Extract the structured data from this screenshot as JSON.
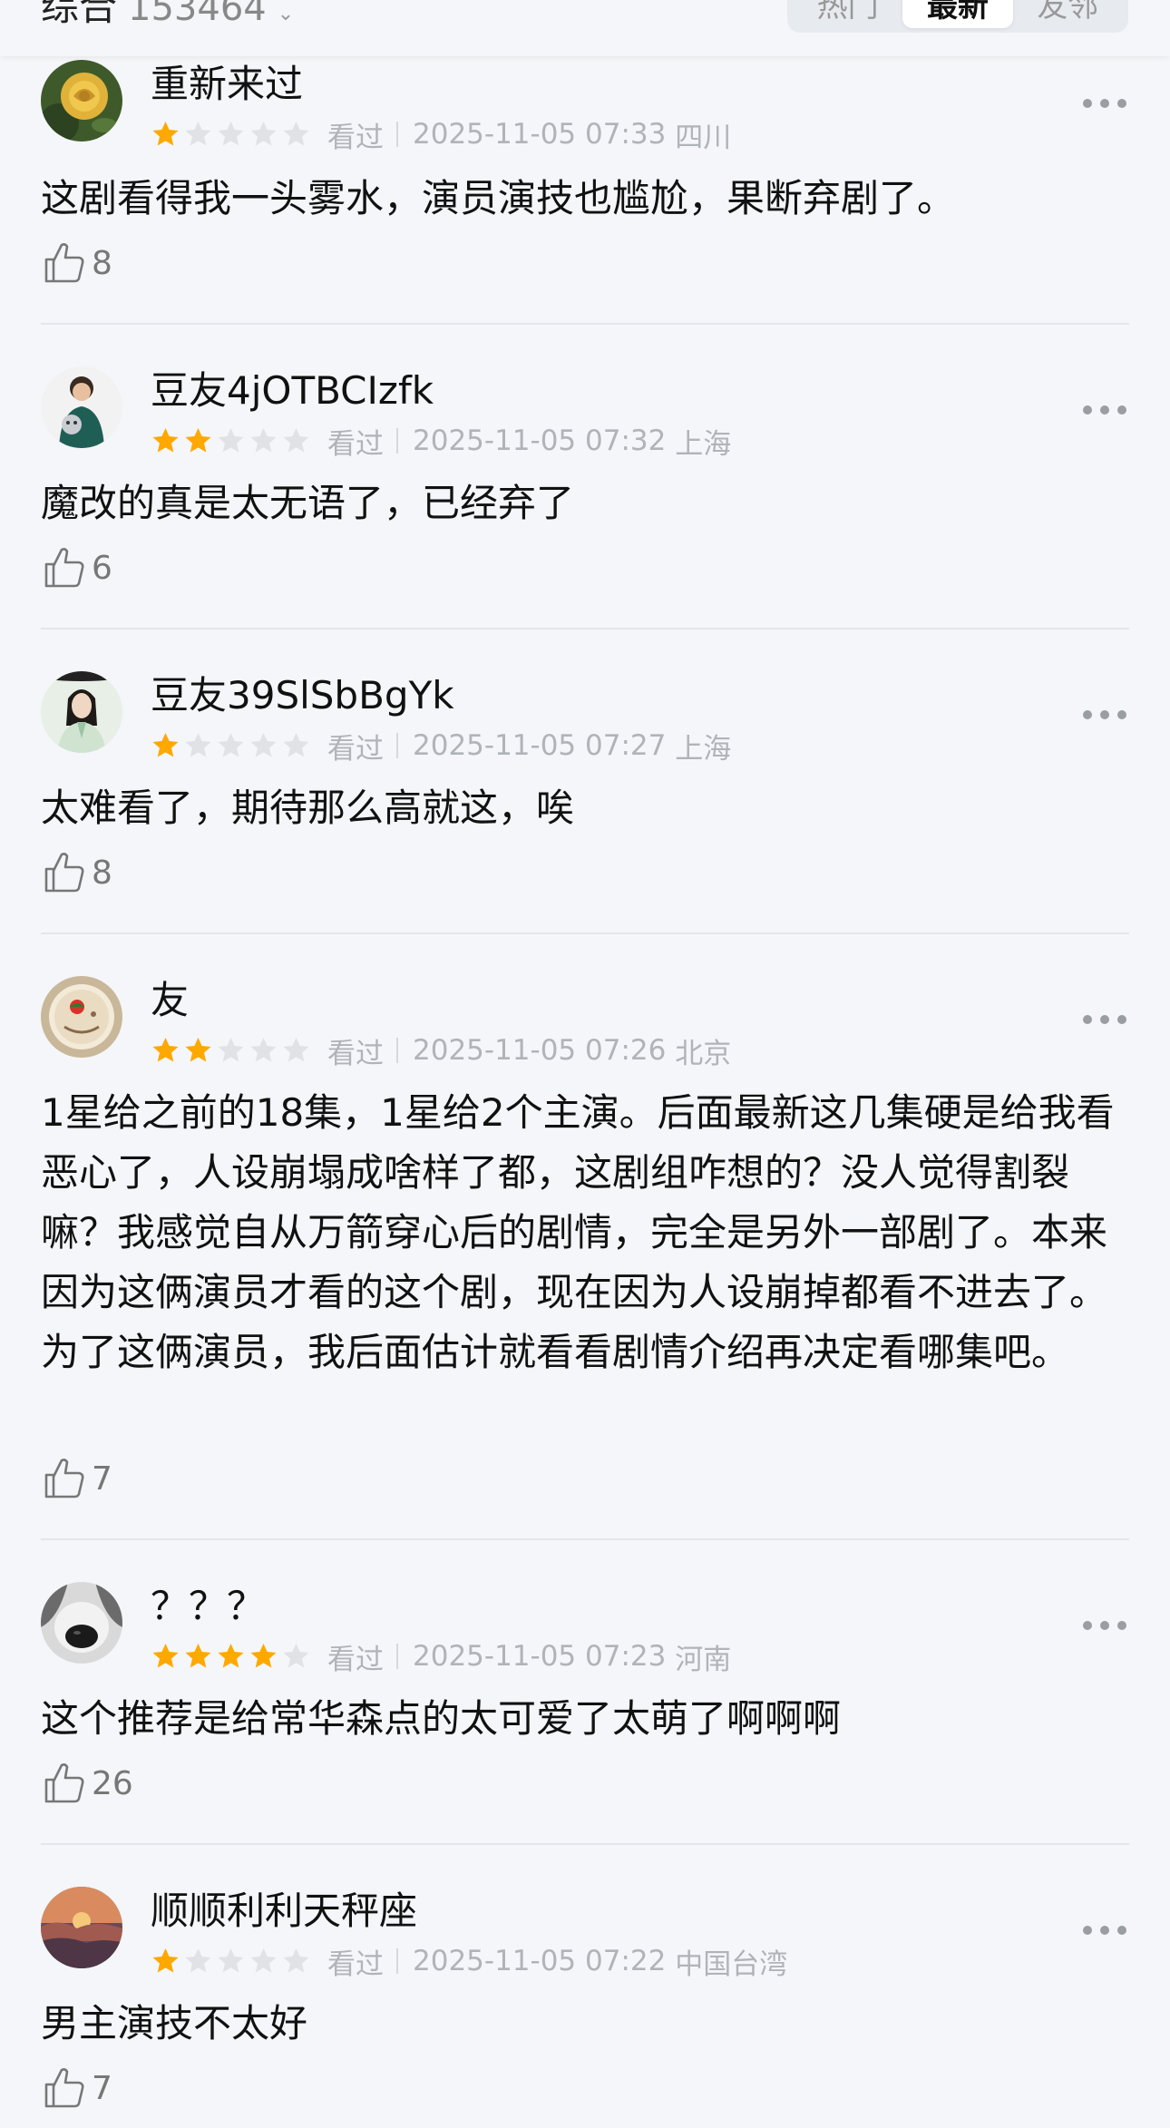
{
  "header": {
    "title": "综合",
    "count": "153464",
    "sort_tabs": [
      "热门",
      "最新",
      "友邻"
    ],
    "active_tab": 1
  },
  "colors": {
    "background": "#f4f6f9",
    "star_active": "#ffa800",
    "star_inactive": "#e0e2e5",
    "meta_text": "#b0b3b8"
  },
  "comments": [
    {
      "username": "重新来过",
      "rating": 1,
      "status": "看过",
      "datetime": "2025-11-05 07:33",
      "location": "四川",
      "text": "这剧看得我一头雾水，演员演技也尴尬，果断弃剧了。",
      "likes": "8",
      "avatar_icon": "yellow-rose-avatar"
    },
    {
      "username": "豆友4jOTBCIzfk",
      "rating": 2,
      "status": "看过",
      "datetime": "2025-11-05 07:32",
      "location": "上海",
      "text": "魔改的真是太无语了，已经弃了",
      "likes": "6",
      "avatar_icon": "person-with-pet-avatar"
    },
    {
      "username": "豆友39SlSbBgYk",
      "rating": 1,
      "status": "看过",
      "datetime": "2025-11-05 07:27",
      "location": "上海",
      "text": "太难看了，期待那么高就这，唉",
      "likes": "8",
      "avatar_icon": "costume-character-avatar"
    },
    {
      "username": "友",
      "rating": 2,
      "status": "看过",
      "datetime": "2025-11-05 07:26",
      "location": "北京",
      "text": "1星给之前的18集，1星给2个主演。后面最新这几集硬是给我看恶心了，人设崩塌成啥样了都，这剧组咋想的？没人觉得割裂嘛？我感觉自从万箭穿心后的剧情，完全是另外一部剧了。本来因为这俩演员才看的这个剧，现在因为人设崩掉都看不进去了。为了这俩演员，我后面估计就看看剧情介绍再决定看哪集吧。",
      "likes": "7",
      "avatar_icon": "round-cake-avatar"
    },
    {
      "username": "？？？",
      "rating": 4,
      "status": "看过",
      "datetime": "2025-11-05 07:23",
      "location": "河南",
      "text": "这个推荐是给常华森点的太可爱了太萌了啊啊啊",
      "likes": "26",
      "avatar_icon": "dog-nose-avatar"
    },
    {
      "username": "顺顺利利天秤座",
      "rating": 1,
      "status": "看过",
      "datetime": "2025-11-05 07:22",
      "location": "中国台湾",
      "text": "男主演技不太好",
      "likes": "7",
      "avatar_icon": "sunset-clouds-avatar"
    }
  ]
}
